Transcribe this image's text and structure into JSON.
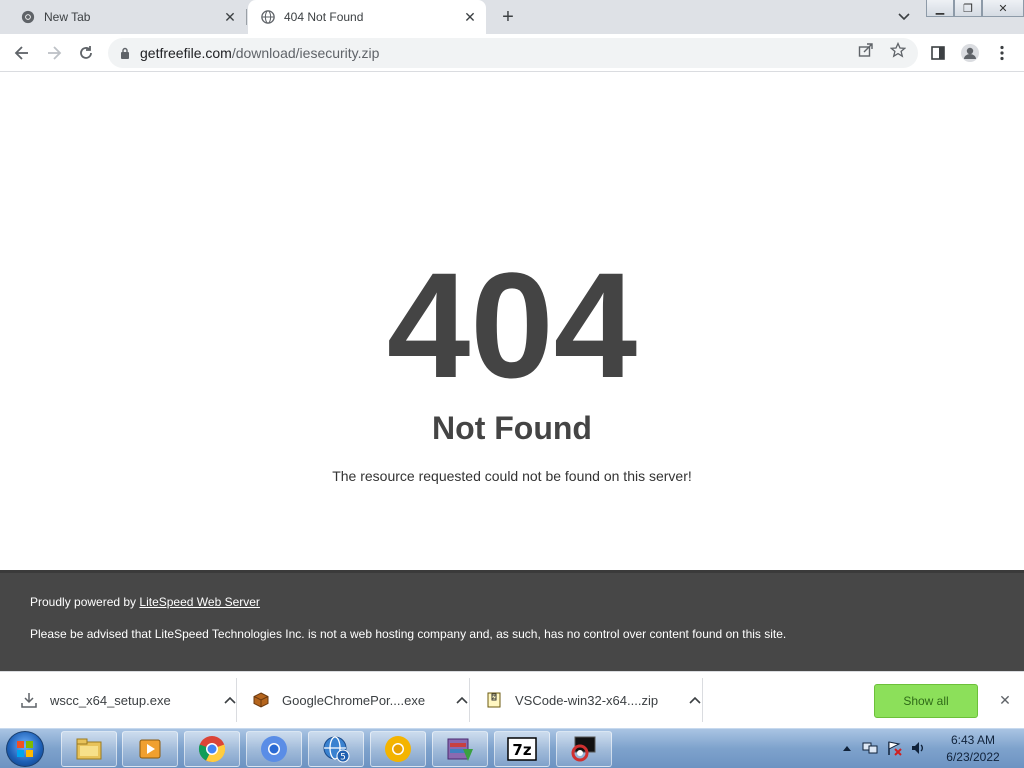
{
  "browser": {
    "tabs": [
      {
        "title": "New Tab",
        "favicon": "chrome-logo-icon",
        "active": false
      },
      {
        "title": "404 Not Found",
        "favicon": "globe-icon",
        "active": true
      }
    ],
    "url_host": "getfreefile.com",
    "url_path": "/download/iesecurity.zip"
  },
  "page": {
    "code": "404",
    "title": "Not Found",
    "description": "The resource requested could not be found on this server!",
    "footer_prefix": "Proudly powered by ",
    "footer_link": "LiteSpeed Web Server",
    "footer_notice": "Please be advised that LiteSpeed Technologies Inc. is not a web hosting company and, as such, has no control over content found on this site."
  },
  "downloads": {
    "items": [
      {
        "name": "wscc_x64_setup.exe",
        "icon": "download-icon"
      },
      {
        "name": "GoogleChromePor....exe",
        "icon": "package-icon"
      },
      {
        "name": "VSCode-win32-x64....zip",
        "icon": "archive-icon"
      }
    ],
    "show_all": "Show all"
  },
  "taskbar": {
    "apps": [
      "file-explorer-icon",
      "media-player-icon",
      "chrome-icon",
      "chromium-icon",
      "network-globe-icon",
      "chrome-canary-icon",
      "winrar-icon",
      "7zip-icon",
      "remote-desktop-icon"
    ],
    "time": "6:43 AM",
    "date": "6/23/2022"
  },
  "colors": {
    "page_text": "#444444",
    "footer_bg": "#474747",
    "tabstrip_bg": "#dee1e6",
    "show_all_bg": "#8ce05a"
  }
}
